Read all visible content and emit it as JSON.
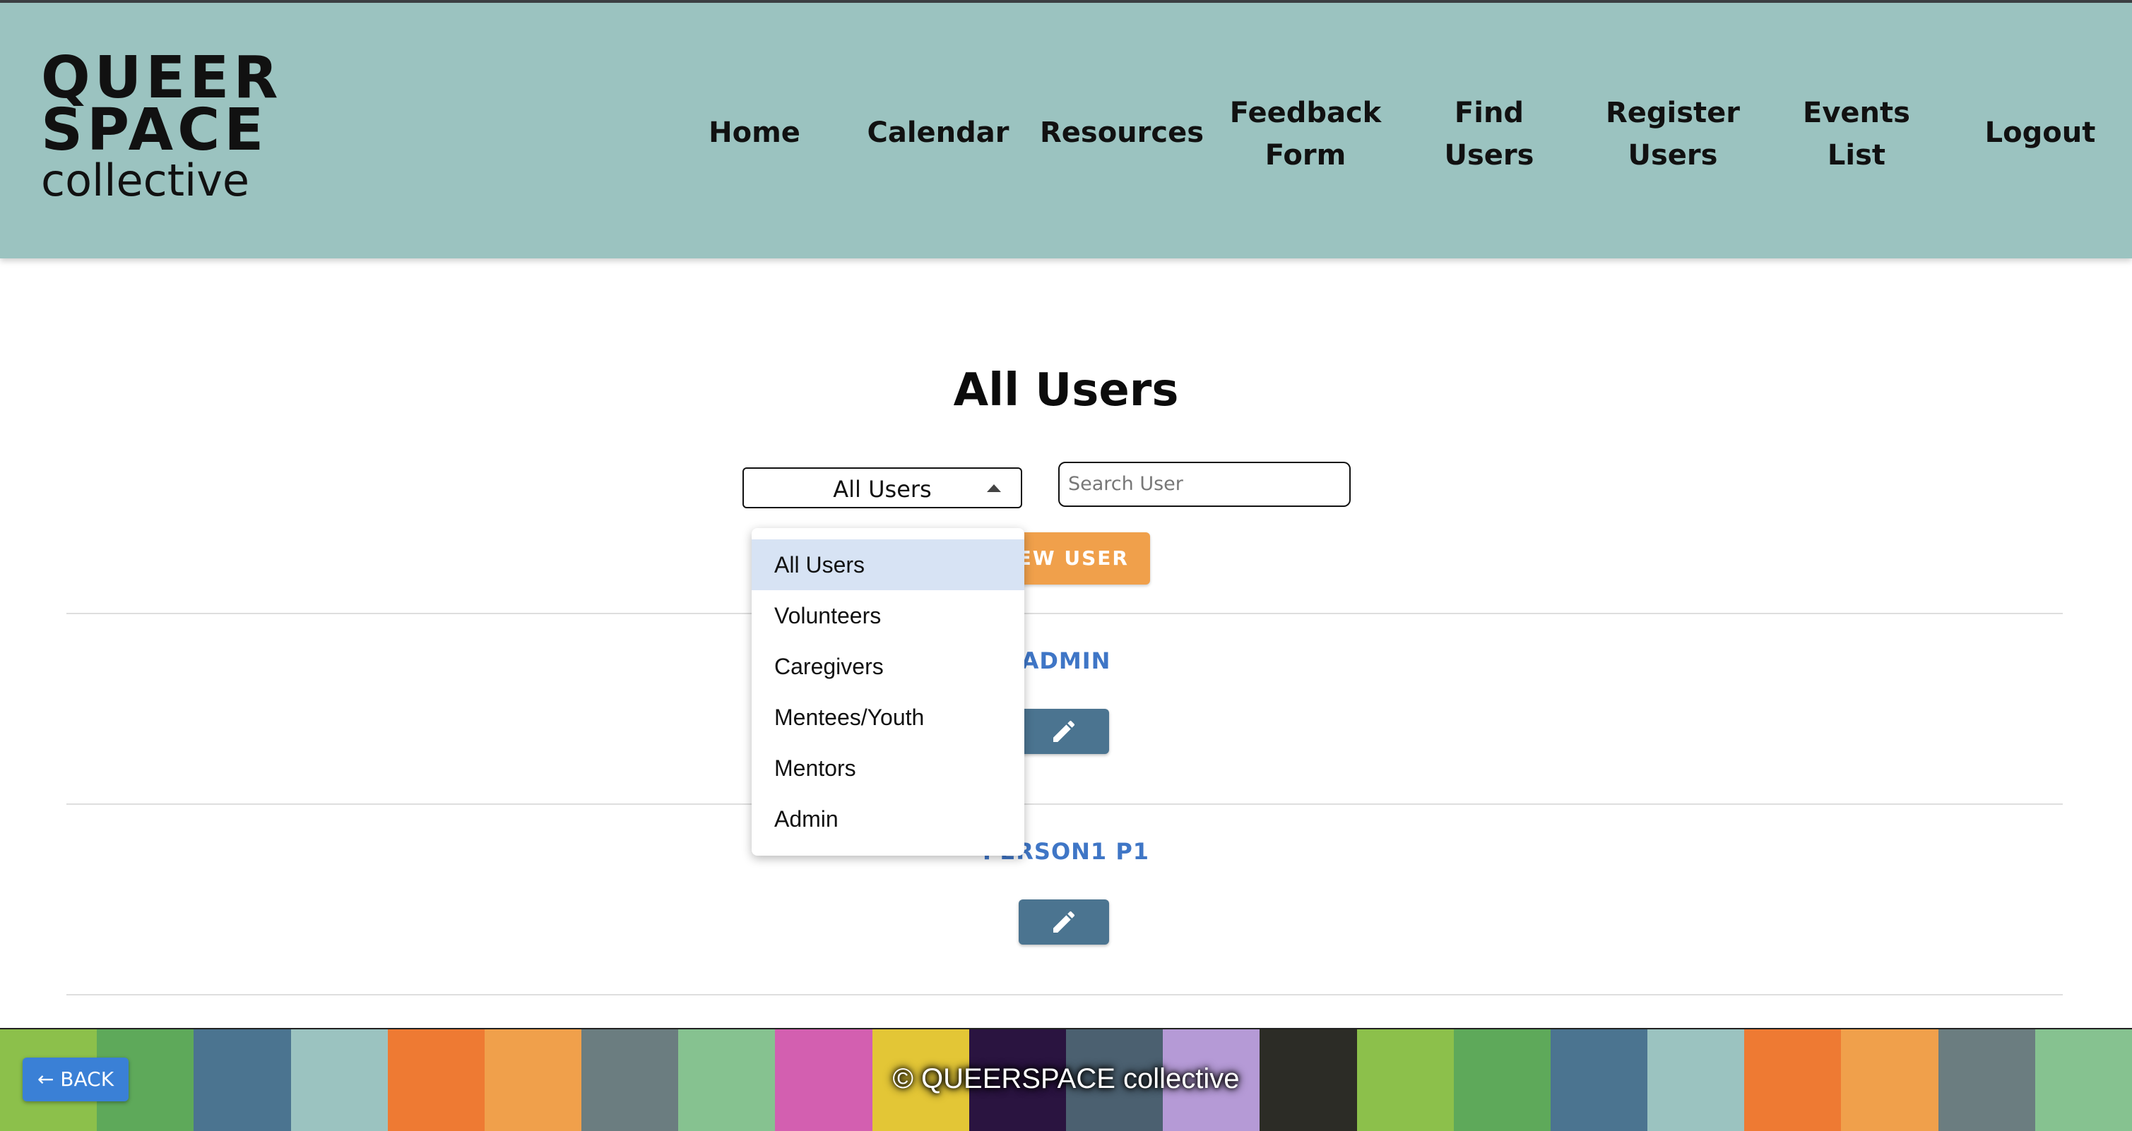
{
  "header": {
    "logo": {
      "line1": "QUEER",
      "line2": "SPACE",
      "line3": "collective"
    },
    "nav": [
      {
        "label": "Home"
      },
      {
        "label": "Calendar"
      },
      {
        "label": "Resources"
      },
      {
        "label": "Feedback Form"
      },
      {
        "label": "Find Users"
      },
      {
        "label": "Register Users"
      },
      {
        "label": "Events List"
      },
      {
        "label": "Logout"
      }
    ]
  },
  "main": {
    "title": "All Users",
    "filter_selected": "All Users",
    "search_placeholder": "Search User",
    "new_user_label": "NEW USER",
    "users": [
      {
        "name": "ADMIN"
      },
      {
        "name": "PERSON1 P1"
      }
    ]
  },
  "dropdown": {
    "options": [
      "All Users",
      "Volunteers",
      "Caregivers",
      "Mentees/Youth",
      "Mentors",
      "Admin"
    ],
    "selected_index": 0
  },
  "footer": {
    "copyright": "© QUEERSPACE collective",
    "back_label": "← BACK",
    "tile_colors": [
      "#8cc04b",
      "#5ea95a",
      "#4b7490",
      "#9bc3c0",
      "#ee7a33",
      "#f0a04b",
      "#6b7d80",
      "#86c290",
      "#d35fb0",
      "#e3c636",
      "#2a1440",
      "#4b6070",
      "#b59ad6",
      "#2c2c26",
      "#8cc04b",
      "#5ea95a",
      "#4b7490",
      "#9bc3c0",
      "#ee7a33",
      "#f0a04b",
      "#6b7d80",
      "#86c290"
    ]
  },
  "colors": {
    "header_bg": "#9bc3c0",
    "accent_orange": "#f0a04b",
    "link_blue": "#3f76c6",
    "edit_button": "#4b7490",
    "back_button": "#3a80d6"
  }
}
